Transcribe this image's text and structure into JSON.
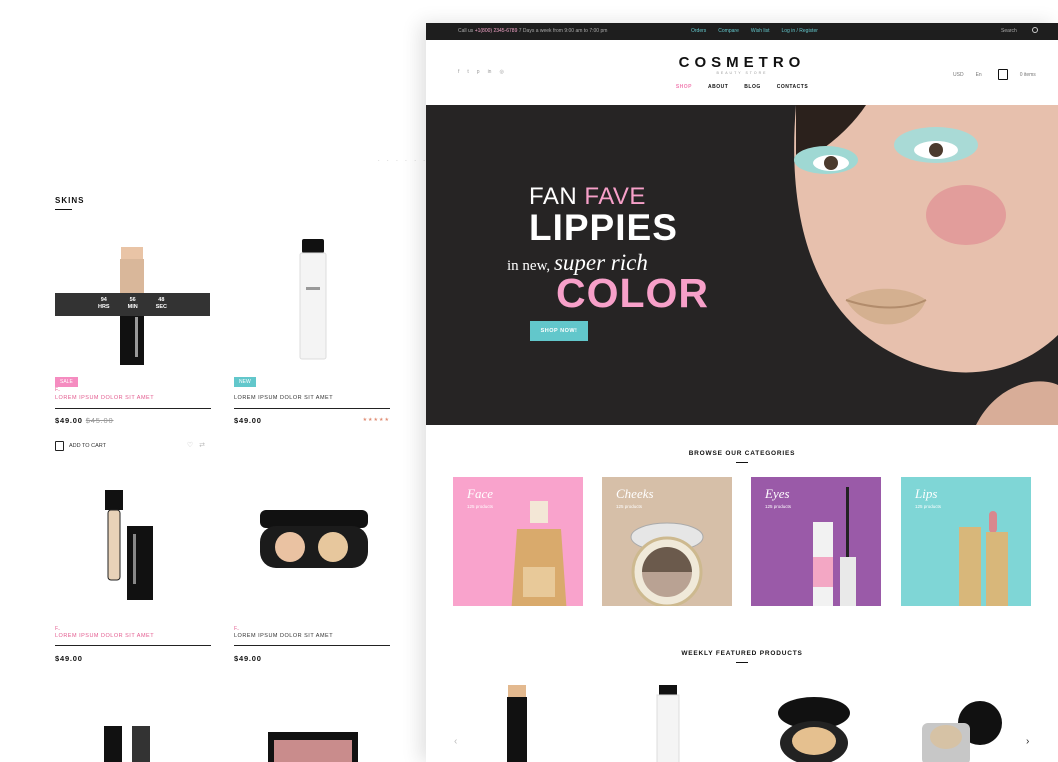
{
  "colors": {
    "pink": "#f7a0c9",
    "teal": "#62c7cb",
    "purple": "#9a5aa8",
    "beige": "#d6bfa8",
    "dark": "#262424"
  },
  "catalog": {
    "section_title": "SKINS",
    "timer": {
      "hours": "94",
      "hours_label": "HRS",
      "minutes": "56",
      "minutes_label": "MIN",
      "seconds": "48",
      "seconds_label": "SEC"
    },
    "products": [
      {
        "badge": "SALE",
        "category": "F..",
        "name": "LOREM IPSUM DOLOR SIT AMET",
        "price": "$49.00",
        "old_price": "$45.00",
        "add_to_cart": "ADD TO CART"
      },
      {
        "badge": "NEW",
        "name": "LOREM IPSUM DOLOR SIT AMET",
        "price": "$49.00",
        "rating": "★★★★★"
      },
      {
        "category": "F..",
        "name": "LOREM IPSUM DOLOR SIT AMET",
        "price": "$49.00"
      },
      {
        "category": "F..",
        "name": "LOREM IPSUM DOLOR SIT AMET",
        "price": "$49.00"
      }
    ]
  },
  "topbar": {
    "call_prefix": "Call us",
    "phone": "+1(800) 2345-6789",
    "hours": "7 Days a week from 9:00 am to 7:00 pm",
    "links": [
      "Orders",
      "Compare",
      "Wish list",
      "Log in / Register"
    ],
    "search": "Search"
  },
  "header": {
    "logo": "COSMETRO",
    "tagline": "BEAUTY STORE",
    "nav": [
      "SHOP",
      "ABOUT",
      "BLOG",
      "CONTACTS"
    ],
    "currency": "USD",
    "language": "En",
    "cart_count": "0 items",
    "social_icons": [
      "facebook-icon",
      "twitter-icon",
      "pinterest-icon",
      "linkedin-icon",
      "instagram-icon"
    ]
  },
  "hero": {
    "line1_a": "FAN",
    "line1_b": "FAVE",
    "line2": "LIPPIES",
    "line3_a": "in new,",
    "line3_b": "super rich",
    "line4": "COLOR",
    "cta": "SHOP NOW!"
  },
  "categories": {
    "title": "BROWSE OUR CATEGORIES",
    "items": [
      {
        "name": "Face",
        "count": "125 products"
      },
      {
        "name": "Cheeks",
        "count": "125 products"
      },
      {
        "name": "Eyes",
        "count": "125 products"
      },
      {
        "name": "Lips",
        "count": "125 products"
      }
    ]
  },
  "featured": {
    "title": "WEEKLY FEATURED PRODUCTS",
    "prev": "‹",
    "next": "›"
  }
}
